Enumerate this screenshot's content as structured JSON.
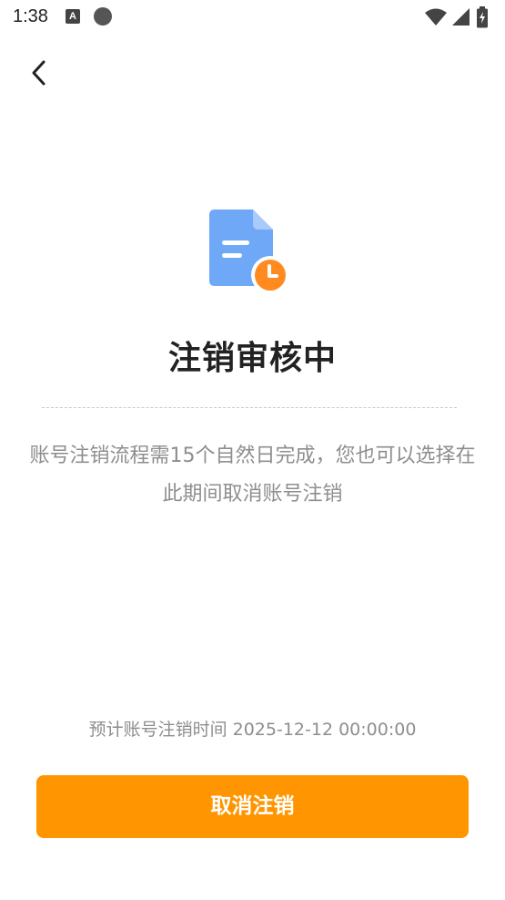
{
  "status_bar": {
    "time": "1:38",
    "icons": [
      "a-notification-icon",
      "circle-notification-icon",
      "wifi-icon",
      "signal-icon",
      "battery-icon"
    ]
  },
  "nav": {
    "back_icon": "chevron-left-icon"
  },
  "review": {
    "icon": "document-clock-icon",
    "title": "注销审核中",
    "description": "账号注销流程需15个自然日完成，您也可以选择在此期间取消账号注销",
    "estimate_label": "预计账号注销时间",
    "estimate_time": "2025-12-12 00:00:00"
  },
  "actions": {
    "cancel_label": "取消注销"
  },
  "colors": {
    "accent": "#ff9500",
    "doc_blue": "#6fa8f7",
    "clock_orange": "#ff8a1f",
    "secondary_text": "#8e8e8e"
  }
}
